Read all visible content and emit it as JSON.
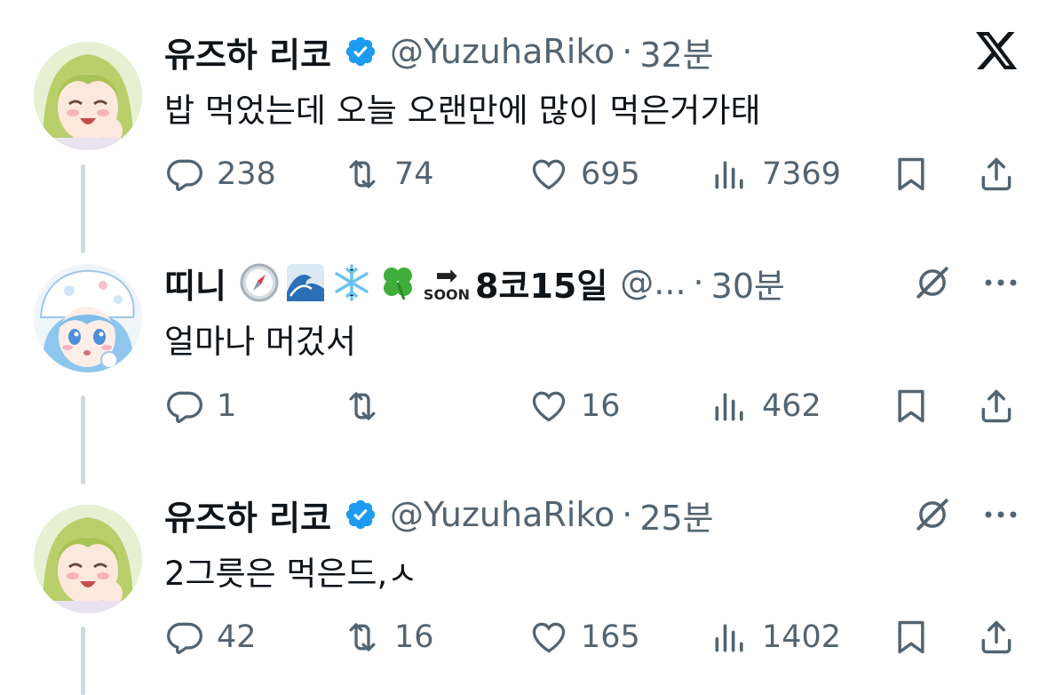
{
  "tweets": [
    {
      "name": "유즈하 리코",
      "handle": "@YuzuhaRiko",
      "separator": "·",
      "time": "32분",
      "text": "밥 먹었는데 오늘 오랜만에 많이 먹은거가태",
      "replies": "238",
      "retweets": "74",
      "likes": "695",
      "views": "7369"
    },
    {
      "name": "띠니",
      "name_suffix": "8코15일",
      "soon_label": "SOON",
      "handle": "@...",
      "separator": "·",
      "time": "30분",
      "text": "얼마나 머겄서",
      "replies": "1",
      "retweets": "",
      "likes": "16",
      "views": "462"
    },
    {
      "name": "유즈하 리코",
      "handle": "@YuzuhaRiko",
      "separator": "·",
      "time": "25분",
      "text": "2그릇은 먹은드,ㅅ",
      "replies": "42",
      "retweets": "16",
      "likes": "165",
      "views": "1402"
    }
  ],
  "icons": {
    "verified": "verified-badge-icon",
    "brand": "x-logo-icon",
    "grok": "grok-icon",
    "more": "more-icon",
    "reply": "reply-icon",
    "retweet": "retweet-icon",
    "like": "like-icon",
    "views": "views-icon",
    "bookmark": "bookmark-icon",
    "share": "share-icon"
  },
  "colors": {
    "verified": "#1d9bf0",
    "text": "#0f1419",
    "muted": "#536471",
    "thread": "#cfd9de"
  }
}
